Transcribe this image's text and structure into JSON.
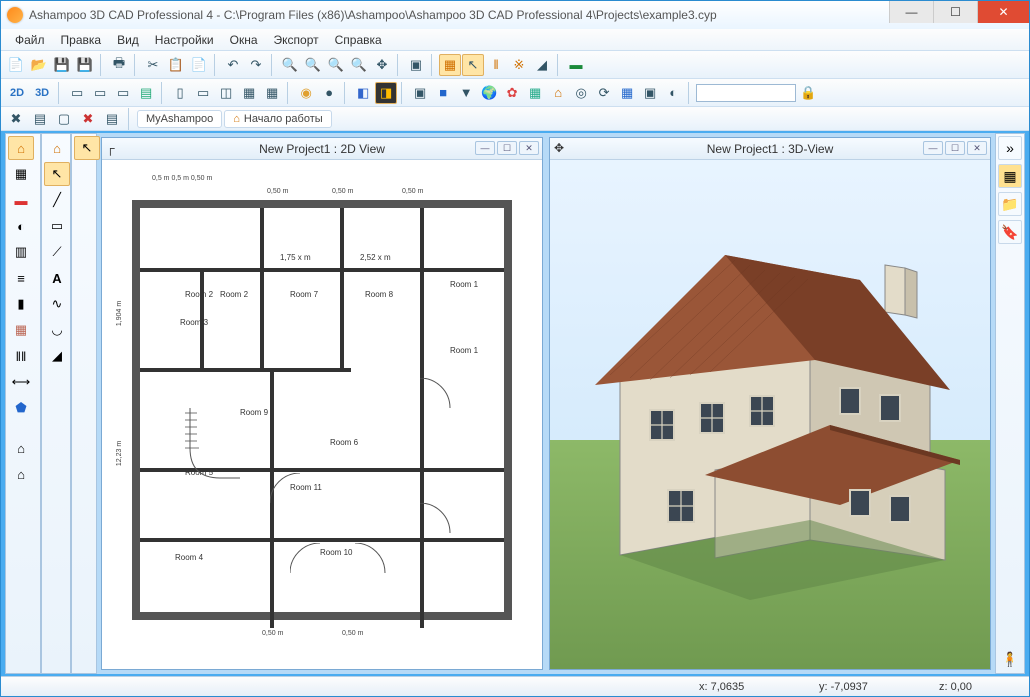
{
  "title": "Ashampoo 3D CAD Professional 4 - C:\\Program Files (x86)\\Ashampoo\\Ashampoo 3D CAD Professional 4\\Projects\\example3.cyp",
  "menu": {
    "file": "Файл",
    "edit": "Правка",
    "view": "Вид",
    "settings": "Настройки",
    "windows": "Окна",
    "export": "Экспорт",
    "help": "Справка"
  },
  "links": {
    "myashampoo": "MyAshampoo",
    "getstarted": "Начало работы"
  },
  "modes": {
    "m2d": "2D",
    "m3d": "3D"
  },
  "panes": {
    "view2d_title": "New Project1 : 2D View",
    "view3d_title": "New Project1 : 3D-View"
  },
  "rooms": {
    "r1a": "Room 1",
    "r1b": "Room 1",
    "r2a": "Room 2",
    "r2b": "Room 2",
    "r3": "Room 3",
    "r4": "Room 4",
    "r5": "Room 5",
    "r6": "Room 6",
    "r7": "Room 7",
    "r8": "Room 8",
    "r9": "Room 9",
    "r10": "Room 10",
    "r11": "Room 11"
  },
  "dims": {
    "top1": "0,50 m",
    "top2": "0,50 m",
    "top3": "0,50 m",
    "left1": "1,904 m",
    "left2": "12,23 m",
    "mid1": "1,75 x m",
    "mid2": "2,52 x m",
    "bot1": "0,50 m",
    "bot2": "0,50 m",
    "tiny": "0,5 m 0,5 m 0,50 m"
  },
  "status": {
    "x": "x: 7,0635",
    "y": "y: -7,0937",
    "z": "z: 0,00"
  }
}
